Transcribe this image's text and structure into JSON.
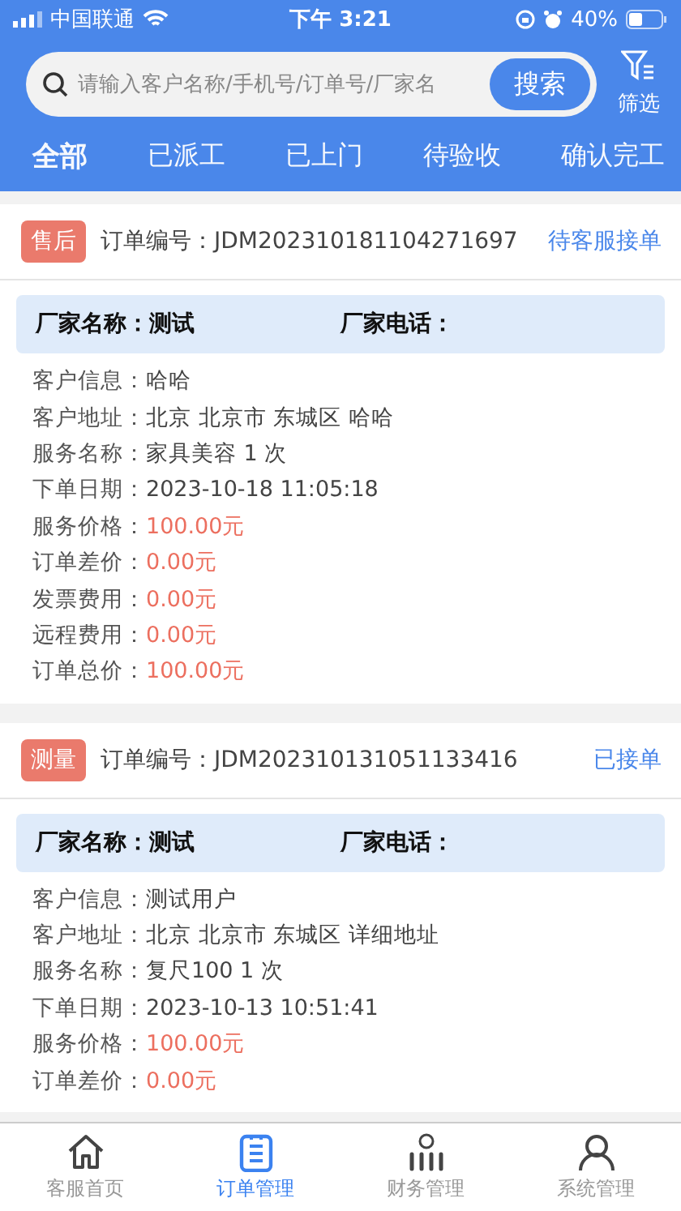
{
  "status_bar": {
    "carrier": "中国联通",
    "time": "下午 3:21",
    "battery": "40%"
  },
  "search": {
    "placeholder": "请输入客户名称/手机号/订单号/厂家名",
    "button": "搜索",
    "filter": "筛选"
  },
  "tabs": [
    {
      "label": "全部",
      "selected": true
    },
    {
      "label": "已派工",
      "selected": false
    },
    {
      "label": "已上门",
      "selected": false
    },
    {
      "label": "待验收",
      "selected": false
    },
    {
      "label": "确认完工",
      "selected": false
    }
  ],
  "orders": [
    {
      "tag": "售后",
      "order_no": "订单编号：JDM202310181104271697",
      "status": "待客服接单",
      "maker_name_label": "厂家名称：",
      "maker_name": "测试",
      "maker_phone_label": "厂家电话：",
      "fields": [
        {
          "label": "客户信息：",
          "value": "哈哈",
          "kind": "text"
        },
        {
          "label": "客户地址：",
          "value": "北京 北京市 东城区 哈哈",
          "kind": "text"
        },
        {
          "label": "服务名称：",
          "value": "家具美容 1 次",
          "kind": "text"
        },
        {
          "label": "下单日期：",
          "value": "2023-10-18 11:05:18",
          "kind": "text"
        },
        {
          "label": "服务价格：",
          "value": "100.00元",
          "kind": "price"
        },
        {
          "label": "订单差价：",
          "value": "0.00元",
          "kind": "price"
        },
        {
          "label": "发票费用：",
          "value": "0.00元",
          "kind": "price"
        },
        {
          "label": "远程费用：",
          "value": "0.00元",
          "kind": "price"
        },
        {
          "label": "订单总价：",
          "value": "100.00元",
          "kind": "price"
        }
      ]
    },
    {
      "tag": "测量",
      "order_no": "订单编号：JDM202310131051133416",
      "status": "已接单",
      "maker_name_label": "厂家名称：",
      "maker_name": "测试",
      "maker_phone_label": "厂家电话：",
      "fields": [
        {
          "label": "客户信息：",
          "value": "测试用户",
          "kind": "text"
        },
        {
          "label": "客户地址：",
          "value": "北京 北京市 东城区 详细地址",
          "kind": "text"
        },
        {
          "label": "服务名称：",
          "value": "复尺100 1 次",
          "kind": "text"
        },
        {
          "label": "下单日期：",
          "value": "2023-10-13 10:51:41",
          "kind": "text"
        },
        {
          "label": "服务价格：",
          "value": "100.00元",
          "kind": "price"
        },
        {
          "label": "订单差价：",
          "value": "0.00元",
          "kind": "price"
        }
      ]
    }
  ],
  "nav": [
    {
      "label": "客服首页",
      "kind": "home",
      "selected": false
    },
    {
      "label": "订单管理",
      "kind": "list",
      "selected": true
    },
    {
      "label": "财务管理",
      "kind": "finance",
      "selected": false
    },
    {
      "label": "系统管理",
      "kind": "user",
      "selected": false
    }
  ]
}
